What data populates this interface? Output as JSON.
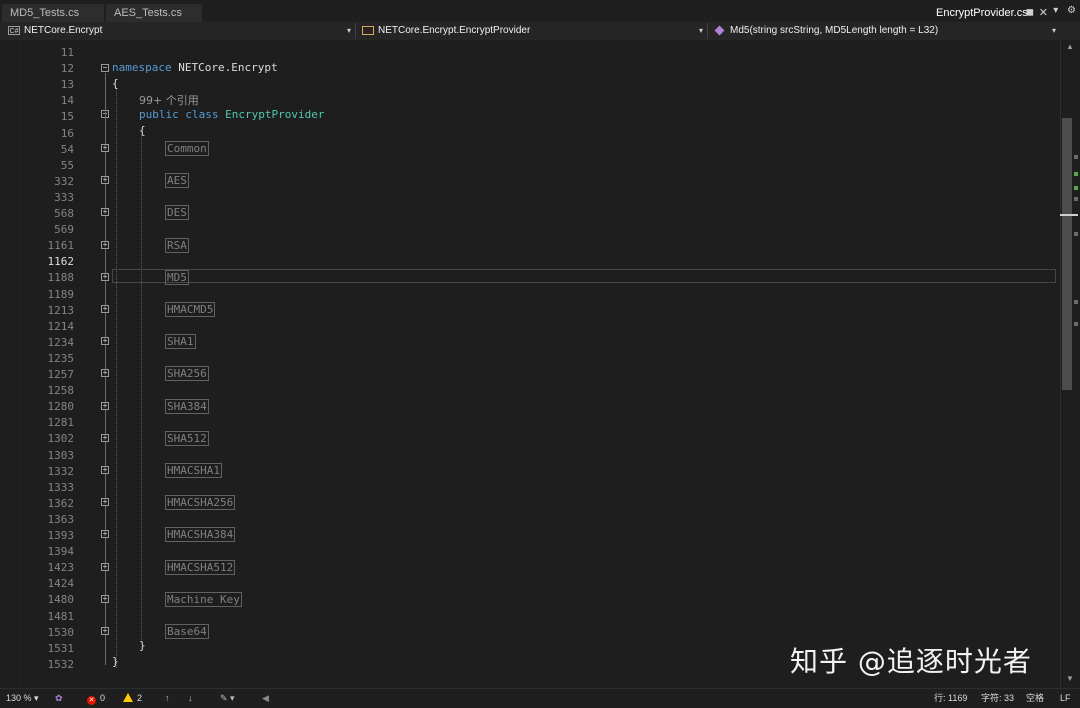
{
  "tabs": [
    {
      "label": "MD5_Tests.cs",
      "active": false
    },
    {
      "label": "AES_Tests.cs",
      "active": false
    },
    {
      "label": "EncryptProvider.cs",
      "active": true
    }
  ],
  "nav": {
    "project": "NETCore.Encrypt",
    "class_path": "NETCore.Encrypt.EncryptProvider",
    "member": "Md5(string srcString, MD5Length length = L32)"
  },
  "code": {
    "namespace_kw": "namespace",
    "namespace_name": "NETCore.Encrypt",
    "open_brace": "{",
    "close_brace": "}",
    "references": "99+ 个引用",
    "class_public": "public",
    "class_kw": "class",
    "class_name": "EncryptProvider"
  },
  "line_numbers": [
    "11",
    "12",
    "13",
    "14",
    "15",
    "16",
    "54",
    "55",
    "332",
    "333",
    "568",
    "569",
    "1161",
    "1162",
    "1188",
    "1189",
    "1213",
    "1214",
    "1234",
    "1235",
    "1257",
    "1258",
    "1280",
    "1281",
    "1302",
    "1303",
    "1332",
    "1333",
    "1362",
    "1363",
    "1393",
    "1394",
    "1423",
    "1424",
    "1480",
    "1481",
    "1530",
    "1531",
    "1532"
  ],
  "current_line": "1162",
  "regions": [
    "Common",
    "AES",
    "DES",
    "RSA",
    "MD5",
    "HMACMD5",
    "SHA1",
    "SHA256",
    "SHA384",
    "SHA512",
    "HMACSHA1",
    "HMACSHA256",
    "HMACSHA384",
    "HMACSHA512",
    "Machine Key",
    "Base64"
  ],
  "status": {
    "zoom": "130 %",
    "errors": "0",
    "warnings": "2",
    "line": "行: 1169",
    "char": "字符: 33",
    "whitespace": "空格",
    "eol": "LF"
  },
  "watermark": "知乎 @追逐时光者",
  "colors": {
    "keyword": "#569cd6",
    "type": "#4ec9b0",
    "error": "#e51400",
    "warning": "#ffcc00"
  }
}
